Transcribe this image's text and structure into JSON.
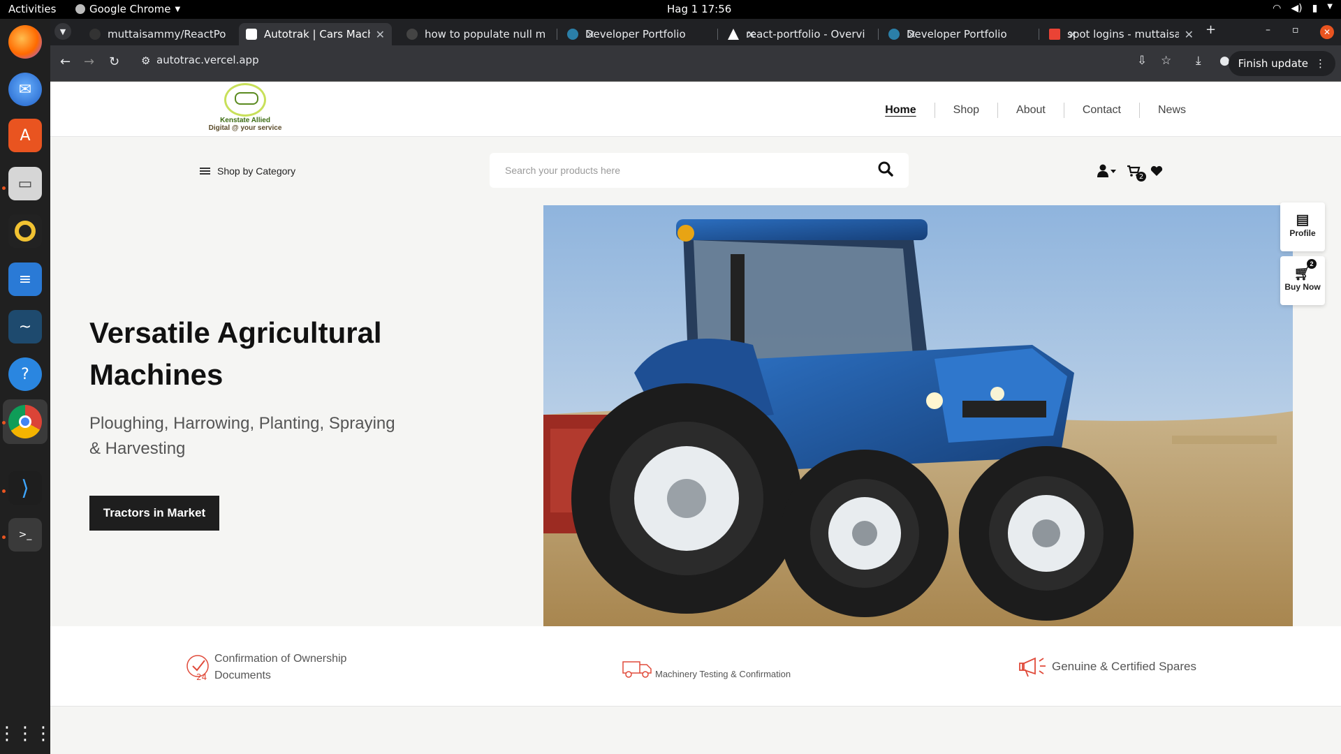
{
  "os": {
    "activities": "Activities",
    "app_name": "Google Chrome",
    "clock": "Hag 1  17:56"
  },
  "browser": {
    "tabs": [
      {
        "title": "muttaisammy/ReactPo",
        "active": false
      },
      {
        "title": "Autotrak | Cars Machine",
        "active": true
      },
      {
        "title": "how to populate null m",
        "active": false
      },
      {
        "title": "Developer Portfolio",
        "active": false
      },
      {
        "title": "react-portfolio - Overvi",
        "active": false
      },
      {
        "title": "Developer Portfolio",
        "active": false
      },
      {
        "title": "spot logins - muttaisam",
        "active": false
      }
    ],
    "url": "autotrac.vercel.app",
    "update_label": "Finish update"
  },
  "site": {
    "logo": {
      "line1": "Kenstate Allied",
      "line2": "Digital @ your service"
    },
    "nav": [
      {
        "label": "Home",
        "active": true
      },
      {
        "label": "Shop",
        "active": false
      },
      {
        "label": "About",
        "active": false
      },
      {
        "label": "Contact",
        "active": false
      },
      {
        "label": "News",
        "active": false
      }
    ],
    "category_label": "Shop by Category",
    "search_placeholder": "Search your products here",
    "cart_count": "2",
    "hero": {
      "title": "Versatile Agricultural Machines",
      "subtitle": "Ploughing, Harrowing, Planting, Spraying & Harvesting",
      "cta": "Tractors in Market"
    },
    "side_actions": {
      "profile": "Profile",
      "buy_now": "Buy Now",
      "buy_count": "2"
    },
    "features": [
      {
        "text": "Confirmation of Ownership Documents"
      },
      {
        "text": "Machinery Testing & Confirmation"
      },
      {
        "text": "Genuine & Certified Spares"
      }
    ],
    "colors": {
      "accent_red": "#e04a3a",
      "logo_green": "#c8e05a",
      "tractor_blue": "#1f5fa8"
    }
  }
}
